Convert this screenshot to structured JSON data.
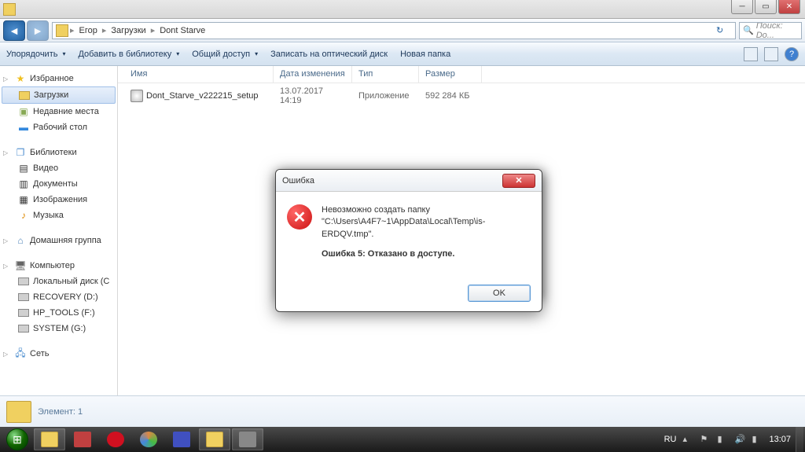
{
  "titlebar": {
    "text": ""
  },
  "breadcrumb": {
    "items": [
      "Егор",
      "Загрузки",
      "Dont Starve"
    ]
  },
  "search": {
    "placeholder": "Поиск: Do..."
  },
  "toolbar": {
    "organize": "Упорядочить",
    "include": "Добавить в библиотеку",
    "share": "Общий доступ",
    "burn": "Записать на оптический диск",
    "newfolder": "Новая папка"
  },
  "sidebar": {
    "favorites": {
      "label": "Избранное",
      "items": [
        "Загрузки",
        "Недавние места",
        "Рабочий стол"
      ]
    },
    "libraries": {
      "label": "Библиотеки",
      "items": [
        "Видео",
        "Документы",
        "Изображения",
        "Музыка"
      ]
    },
    "homegroup": {
      "label": "Домашняя группа"
    },
    "computer": {
      "label": "Компьютер",
      "items": [
        "Локальный диск (C",
        "RECOVERY (D:)",
        "HP_TOOLS (F:)",
        "SYSTEM (G:)"
      ]
    },
    "network": {
      "label": "Сеть"
    }
  },
  "columns": {
    "name": "Имя",
    "date": "Дата изменения",
    "type": "Тип",
    "size": "Размер"
  },
  "files": [
    {
      "name": "Dont_Starve_v222215_setup",
      "date": "13.07.2017 14:19",
      "type": "Приложение",
      "size": "592 284 КБ"
    }
  ],
  "status": {
    "text": "Элемент: 1"
  },
  "dialog": {
    "title": "Ошибка",
    "line1": "Невозможно создать папку",
    "line2": "\"C:\\Users\\A4F7~1\\AppData\\Local\\Temp\\is-ERDQV.tmp\".",
    "line3": "Ошибка 5: Отказано в доступе.",
    "ok": "OK"
  },
  "tray": {
    "lang": "RU",
    "time": "13:07"
  }
}
